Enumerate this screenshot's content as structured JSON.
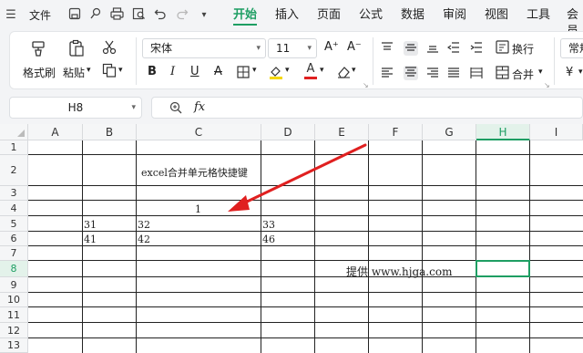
{
  "menubar": {
    "menu_glyph": "☰",
    "file_label": "文件",
    "tabs": [
      "开始",
      "插入",
      "页面",
      "公式",
      "数据",
      "审阅",
      "视图",
      "工具",
      "会员"
    ],
    "active_tab": "开始"
  },
  "ribbon": {
    "format_painter": "格式刷",
    "paste": "粘贴",
    "font_name": "宋体",
    "font_size": "11",
    "wrap_text": "换行",
    "merge": "合并",
    "number_format": "常规",
    "currency_symbol": "¥",
    "bold": "B",
    "italic": "I",
    "underline": "U",
    "strike": "A",
    "font_color_glyph": "A",
    "grow_font": "A⁺",
    "shrink_font": "A⁻"
  },
  "formula_bar": {
    "cell_ref": "H8",
    "fx": "fx"
  },
  "sheet": {
    "columns": [
      "A",
      "B",
      "C",
      "D",
      "E",
      "F",
      "G",
      "H",
      "I"
    ],
    "selected_column": "H",
    "rows": [
      "1",
      "2",
      "3",
      "4",
      "5",
      "6",
      "7",
      "8",
      "9",
      "10",
      "11",
      "12",
      "13"
    ],
    "selected_row": "8",
    "cells": {
      "C2": "excel合并单元格快捷键",
      "C4": "1",
      "B5": "31",
      "C5": "32",
      "D5": "33",
      "B6": "41",
      "C6": "42",
      "D6": "46",
      "E8": "提供 www.hjga.com"
    }
  },
  "colors": {
    "accent": "#1e9e63",
    "arrow": "#e02020",
    "highlight_yellow": "#f5d800",
    "font_red": "#e02020"
  }
}
